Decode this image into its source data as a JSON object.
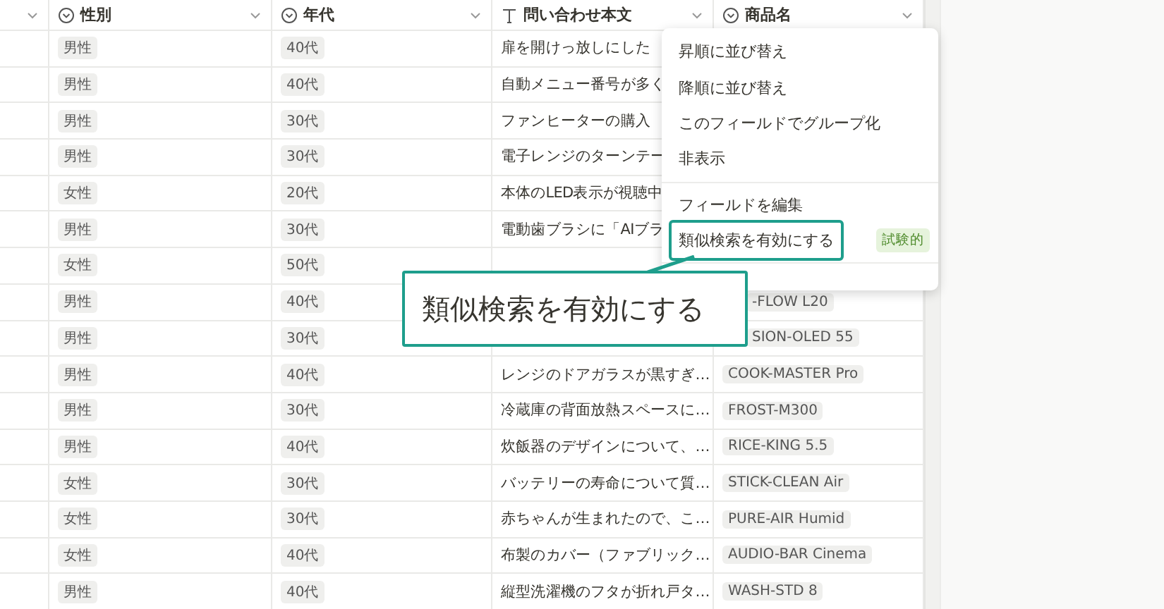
{
  "columns": [
    {
      "kind": "blank"
    },
    {
      "kind": "select",
      "label": "性別"
    },
    {
      "kind": "select",
      "label": "年代"
    },
    {
      "kind": "text",
      "label": "問い合わせ本文"
    },
    {
      "kind": "select",
      "label": "商品名"
    }
  ],
  "rows": [
    {
      "gender": "男性",
      "age": "40代",
      "inquiry": "扉を開けっ放しにした"
    },
    {
      "gender": "男性",
      "age": "40代",
      "inquiry": "自動メニュー番号が多く"
    },
    {
      "gender": "男性",
      "age": "30代",
      "inquiry": "ファンヒーターの購入"
    },
    {
      "gender": "男性",
      "age": "30代",
      "inquiry": "電子レンジのターンテー"
    },
    {
      "gender": "女性",
      "age": "20代",
      "inquiry": "本体のLED表示が視聴中"
    },
    {
      "gender": "男性",
      "age": "30代",
      "inquiry": "電動歯ブラシに「AIブラ"
    },
    {
      "gender": "女性",
      "age": "50代"
    },
    {
      "gender": "男性",
      "age": "40代",
      "product": "-FLOW L20",
      "partly_hidden": true
    },
    {
      "gender": "男性",
      "age": "30代",
      "product": "SION-OLED 55",
      "partly_hidden": true
    },
    {
      "gender": "男性",
      "age": "40代",
      "inquiry": "レンジのドアガラスが黒すぎ…",
      "product": "COOK-MASTER Pro"
    },
    {
      "gender": "男性",
      "age": "30代",
      "inquiry": "冷蔵庫の背面放熱スペースに…",
      "product": "FROST-M300"
    },
    {
      "gender": "男性",
      "age": "40代",
      "inquiry": "炊飯器のデザインについて、…",
      "product": "RICE-KING 5.5"
    },
    {
      "gender": "女性",
      "age": "30代",
      "inquiry": "バッテリーの寿命について質…",
      "product": "STICK-CLEAN Air"
    },
    {
      "gender": "女性",
      "age": "30代",
      "inquiry": "赤ちゃんが生まれたので、こ…",
      "product": "PURE-AIR Humid"
    },
    {
      "gender": "女性",
      "age": "40代",
      "inquiry": "布製のカバー（ファブリック…",
      "product": "AUDIO-BAR Cinema"
    },
    {
      "gender": "男性",
      "age": "40代",
      "inquiry": "縦型洗濯機のフタが折れ戸タ…",
      "product": "WASH-STD 8"
    }
  ],
  "menu": {
    "items": [
      {
        "kind": "item",
        "label": "昇順に並び替え",
        "selected": false
      },
      {
        "kind": "item",
        "label": "降順に並び替え",
        "selected": false
      },
      {
        "kind": "item",
        "label": "このフィールドでグループ化",
        "selected": false
      },
      {
        "kind": "item",
        "label": "非表示",
        "selected": false
      },
      {
        "kind": "divider"
      },
      {
        "kind": "item",
        "label": "フィールドを編集",
        "selected": false
      },
      {
        "kind": "item",
        "label": "類似検索を有効にする",
        "selected": true,
        "badge": "試験的"
      },
      {
        "kind": "divider"
      }
    ]
  },
  "callout": {
    "text": "類似検索を有効にする"
  }
}
